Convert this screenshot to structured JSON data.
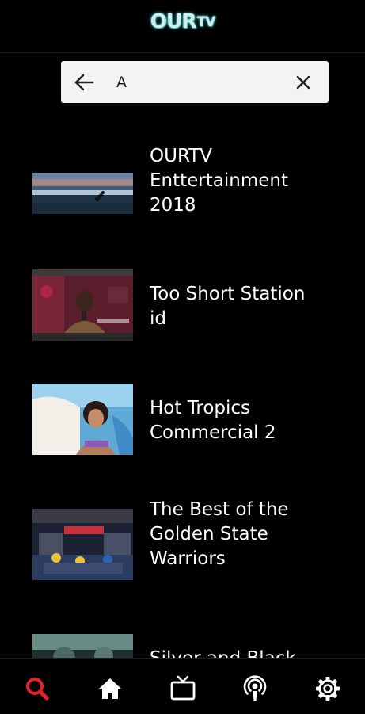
{
  "header": {
    "logo_main": "OUR",
    "logo_suffix": "TV"
  },
  "search": {
    "value": "A",
    "back_icon": "arrow-left-icon",
    "clear_icon": "close-icon"
  },
  "results": [
    {
      "title_lines": [
        "OURTV",
        "Enttertainment",
        "2018"
      ],
      "thumbnail": "beach-surf-scene"
    },
    {
      "title_lines": [
        "Too Short Station",
        "id"
      ],
      "thumbnail": "man-with-microphone"
    },
    {
      "title_lines": [
        "Hot Tropics",
        "Commercial 2"
      ],
      "thumbnail": "woman-in-pool"
    },
    {
      "title_lines": [
        "The Best of the",
        "Golden State",
        "Warriors"
      ],
      "thumbnail": "basketball-arena"
    },
    {
      "title_lines": [
        "Silver and Black"
      ],
      "thumbnail": "arena-partial"
    }
  ],
  "nav": {
    "items": [
      {
        "icon": "search-icon",
        "active": true
      },
      {
        "icon": "home-icon",
        "active": false
      },
      {
        "icon": "tv-icon",
        "active": false
      },
      {
        "icon": "podcast-icon",
        "active": false
      },
      {
        "icon": "settings-icon",
        "active": false
      }
    ]
  },
  "colors": {
    "background": "#000000",
    "active_nav": "#e8202a",
    "inactive_nav": "#ffffff",
    "search_bg": "#f2f3f5"
  }
}
